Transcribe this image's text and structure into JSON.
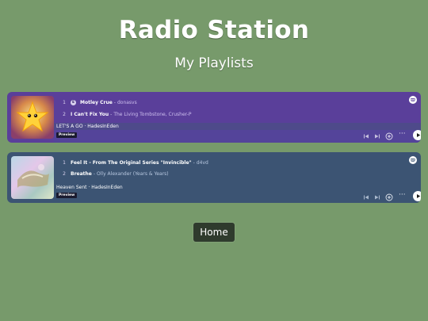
{
  "page": {
    "title": "Radio Station",
    "section_title": "My Playlists",
    "home_label": "Home"
  },
  "colors": {
    "background": "#779a6b",
    "widget1_bg": "#5a3f9a",
    "widget2_bg": "#3c5473",
    "home_bg": "#2f3b2d"
  },
  "widgets": [
    {
      "tracks": [
        {
          "num": "1",
          "explicit": "E",
          "title": "Motley Crue",
          "artist": "donasvs"
        },
        {
          "num": "2",
          "title": "I Can't Fix You",
          "artist": "The Living Tombstone, Crusher-P"
        }
      ],
      "now_playing": "LET'S A GO · HadesInEden",
      "preview_label": "Preview",
      "cover_icon": "star-cover"
    },
    {
      "tracks": [
        {
          "num": "1",
          "title": "Feel It - From The Original Series \"Invincible\"",
          "artist": "d4vd"
        },
        {
          "num": "2",
          "title": "Breathe",
          "artist": "Olly Alexander (Years & Years)"
        }
      ],
      "now_playing": "Heaven Sent · HadesInEden",
      "preview_label": "Preview",
      "cover_icon": "holographic-cover"
    }
  ],
  "controls": {
    "more_glyph": "···"
  }
}
